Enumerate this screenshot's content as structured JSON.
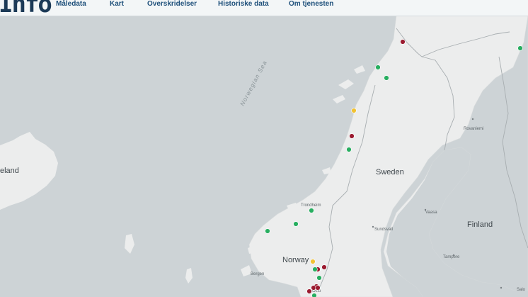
{
  "header": {
    "logo_text": "Info",
    "nav": [
      {
        "label": "Måledata"
      },
      {
        "label": "Kart"
      },
      {
        "label": "Overskridelser"
      },
      {
        "label": "Historiske data"
      },
      {
        "label": "Om tjenesten"
      }
    ]
  },
  "map": {
    "labels": {
      "sea": "Norwegian Sea",
      "iceland": "eland",
      "norway": "Norway",
      "sweden": "Sweden",
      "finland": "Finland",
      "rovaniemi": "Rovaniemi",
      "trondheim": "Trondheim",
      "bergen": "Bergen",
      "sundsvall": "Sundsvall",
      "vaasa": "Vaasa",
      "tampere": "Tampere",
      "oslo": "Oslo",
      "salo": "Salo"
    },
    "colors": {
      "good": "#27ae60",
      "moderate": "#f1c232",
      "bad": "#9b1b30",
      "water": "#cdd3d6",
      "land": "#eceded"
    },
    "stations": [
      {
        "status": "bad"
      },
      {
        "status": "good"
      },
      {
        "status": "good"
      },
      {
        "status": "good"
      },
      {
        "status": "moderate"
      },
      {
        "status": "bad"
      },
      {
        "status": "good"
      },
      {
        "status": "good"
      },
      {
        "status": "good"
      },
      {
        "status": "good"
      },
      {
        "status": "moderate"
      },
      {
        "status": "bad"
      },
      {
        "status": "bad"
      },
      {
        "status": "good"
      },
      {
        "status": "good"
      },
      {
        "status": "bad"
      },
      {
        "status": "bad"
      },
      {
        "status": "bad"
      },
      {
        "status": "bad"
      },
      {
        "status": "good"
      }
    ]
  }
}
